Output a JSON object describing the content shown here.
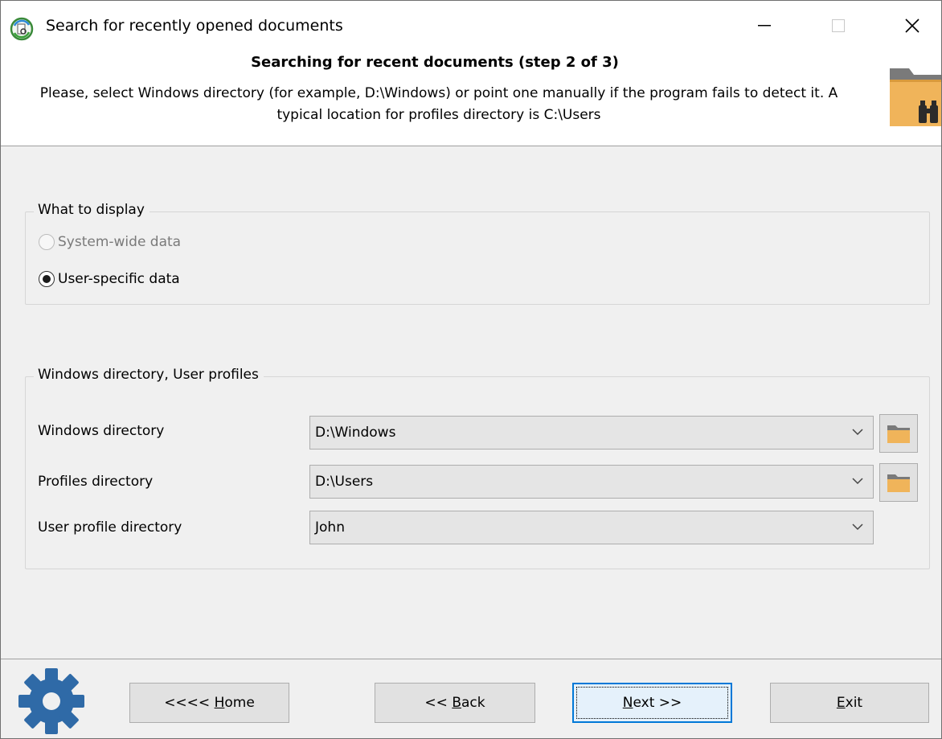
{
  "window": {
    "title": "Search for recently opened documents",
    "icons": {
      "app": "app-icon",
      "minimize": "minimize-icon",
      "maximize": "maximize-icon",
      "close": "close-icon"
    }
  },
  "header": {
    "title": "Searching for recent documents (step 2 of 3)",
    "description": "Please, select Windows directory (for example, D:\\Windows) or point one manually if the program fails to detect it. A typical location for profiles directory is C:\\Users",
    "icon": "folder-binoculars-icon"
  },
  "display_group": {
    "legend": "What to display",
    "options": [
      {
        "label": "System-wide data",
        "selected": false,
        "enabled": false
      },
      {
        "label": "User-specific data",
        "selected": true,
        "enabled": true
      }
    ]
  },
  "dirs_group": {
    "legend": "Windows directory, User profiles",
    "fields": [
      {
        "label": "Windows directory",
        "value": "D:\\Windows"
      },
      {
        "label": "Profiles directory",
        "value": "D:\\Users"
      },
      {
        "label": "User profile directory",
        "value": "John"
      }
    ]
  },
  "footer": {
    "icon": "gear-icon",
    "buttons": {
      "home": {
        "prefix": "<<<< ",
        "accel": "H",
        "rest": "ome"
      },
      "back": {
        "prefix": "<< ",
        "accel": "B",
        "rest": "ack"
      },
      "next": {
        "prefix": "",
        "accel": "N",
        "rest": "ext >>"
      },
      "exit": {
        "prefix": "",
        "accel": "E",
        "rest": "xit"
      }
    }
  },
  "colors": {
    "folder": "#f0b45a",
    "gear": "#2f6aa7",
    "focus_border": "#0078d7"
  }
}
